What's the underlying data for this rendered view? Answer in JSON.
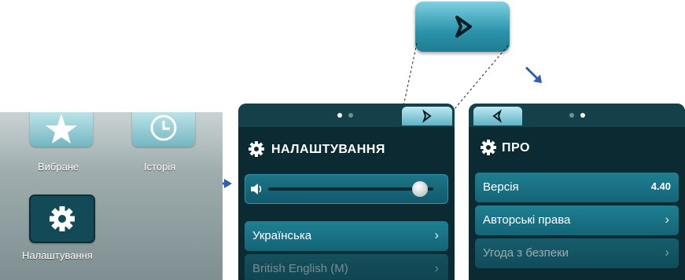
{
  "home": {
    "tiles": [
      {
        "label": "Вибране",
        "icon": "star-icon"
      },
      {
        "label": "Історія",
        "icon": "clock-icon"
      },
      {
        "label": "Налаштування",
        "icon": "gear-icon"
      }
    ]
  },
  "zoom": {
    "icon": "chevron-right-icon"
  },
  "settings_screen": {
    "title": "НАЛАШТУВАННЯ",
    "volume_level": 0.92,
    "items": [
      {
        "label": "Українська"
      },
      {
        "label": "British English (M)"
      }
    ]
  },
  "about_screen": {
    "title": "ПРО",
    "items": [
      {
        "label": "Версія",
        "value": "4.40"
      },
      {
        "label": "Авторські права"
      },
      {
        "label": "Угода з безпеки"
      }
    ]
  },
  "colors": {
    "screen_bg": "#0b2a31",
    "row_bg": "#1a7388",
    "accent_arrow": "#2f5db3"
  }
}
